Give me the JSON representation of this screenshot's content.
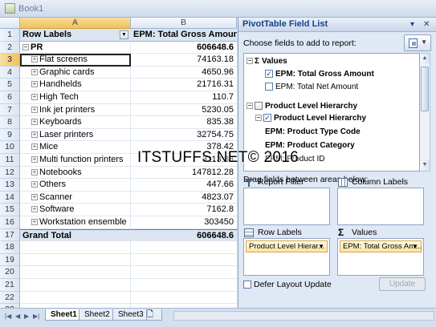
{
  "window": {
    "title": "Book1"
  },
  "sheet": {
    "columns": [
      "A",
      "B"
    ],
    "header": {
      "row": "1",
      "label_col": "Row Labels",
      "value_col": "EPM: Total Gross Amount"
    },
    "rows": [
      {
        "num": "2",
        "label": "PR",
        "value": "606648.6",
        "bold": true,
        "expander": "⊟"
      },
      {
        "num": "3",
        "label": "Flat screens",
        "value": "74163.18",
        "expander": "⊞",
        "selected": true
      },
      {
        "num": "4",
        "label": "Graphic cards",
        "value": "4650.96",
        "expander": "⊞"
      },
      {
        "num": "5",
        "label": "Handhelds",
        "value": "21716.31",
        "expander": "⊞"
      },
      {
        "num": "6",
        "label": "High Tech",
        "value": "110.7",
        "expander": "⊞"
      },
      {
        "num": "7",
        "label": "Ink jet printers",
        "value": "5230.05",
        "expander": "⊞"
      },
      {
        "num": "8",
        "label": "Keyboards",
        "value": "835.38",
        "expander": "⊞"
      },
      {
        "num": "9",
        "label": "Laser printers",
        "value": "32754.75",
        "expander": "⊞"
      },
      {
        "num": "10",
        "label": "Mice",
        "value": "378.42",
        "expander": "⊞"
      },
      {
        "num": "11",
        "label": "Multi function printers",
        "value": "3113.88",
        "expander": "⊞"
      },
      {
        "num": "12",
        "label": "Notebooks",
        "value": "147812.28",
        "expander": "⊞"
      },
      {
        "num": "13",
        "label": "Others",
        "value": "447.66",
        "expander": "⊞"
      },
      {
        "num": "14",
        "label": "Scanner",
        "value": "4823.07",
        "expander": "⊞"
      },
      {
        "num": "15",
        "label": "Software",
        "value": "7162.8",
        "expander": "⊞"
      },
      {
        "num": "16",
        "label": "Workstation ensemble",
        "value": "303450",
        "expander": "⊞"
      }
    ],
    "total": {
      "num": "17",
      "label": "Grand Total",
      "value": "606648.6"
    },
    "empty_rows": [
      "18",
      "19",
      "20",
      "21",
      "22",
      "23"
    ]
  },
  "tabs": {
    "items": [
      "Sheet1",
      "Sheet2",
      "Sheet3"
    ],
    "active": "Sheet1"
  },
  "field_list": {
    "title": "PivotTable Field List",
    "choose_label": "Choose fields to add to report:",
    "values_group": "Values",
    "values_items": [
      {
        "label": "EPM: Total Gross Amount",
        "checked": true
      },
      {
        "label": "EPM: Total Net Amount",
        "checked": false
      }
    ],
    "hierarchy_group": "Product Level Hierarchy",
    "hierarchy_sub": "Product Level Hierarchy",
    "hierarchy_fields": [
      "EPM: Product Type Code",
      "EPM: Product Category",
      "EPM: Product ID"
    ],
    "drag_label": "Drag fields between areas below:",
    "areas": {
      "report_filter": "Report Filter",
      "column_labels": "Column Labels",
      "row_labels": "Row Labels",
      "values": "Values"
    },
    "row_chip": "Product Level Hierar...",
    "values_chip": "EPM: Total Gross Am...",
    "defer_label": "Defer Layout Update",
    "update_label": "Update"
  },
  "watermark": "ITSTUFFS.NET© 2016"
}
